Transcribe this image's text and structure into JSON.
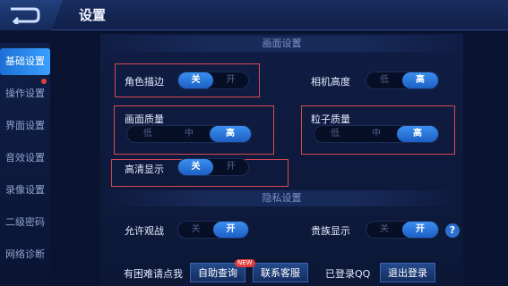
{
  "header": {
    "title": "设置"
  },
  "sidebar": {
    "items": [
      {
        "label": "基础设置"
      },
      {
        "label": "操作设置"
      },
      {
        "label": "界面设置"
      },
      {
        "label": "音效设置"
      },
      {
        "label": "录像设置"
      },
      {
        "label": "二级密码"
      },
      {
        "label": "网络诊断"
      }
    ],
    "active_index": 0
  },
  "sections": {
    "display": {
      "title": "画面设置"
    },
    "privacy": {
      "title": "隐私设置"
    }
  },
  "settings": {
    "outline": {
      "label": "角色描边",
      "options": [
        "关",
        "开"
      ],
      "selected": "关"
    },
    "camera_height": {
      "label": "相机高度",
      "options": [
        "低",
        "高"
      ],
      "selected": "高"
    },
    "image_quality": {
      "label": "画面质量",
      "options": [
        "低",
        "中",
        "高"
      ],
      "selected": "高"
    },
    "particle_quality": {
      "label": "粒子质量",
      "options": [
        "低",
        "中",
        "高"
      ],
      "selected": "高"
    },
    "hd_display": {
      "label": "高清显示",
      "options": [
        "关",
        "开"
      ],
      "selected": "关"
    },
    "allow_watch": {
      "label": "允许观战",
      "options": [
        "关",
        "开"
      ],
      "selected": "开"
    },
    "noble_display": {
      "label": "贵族显示",
      "options": [
        "关",
        "开"
      ],
      "selected": "开"
    }
  },
  "footer": {
    "help_text": "有困难请点我",
    "self_query": "自助查询",
    "new_badge": "NEW",
    "contact": "联系客服",
    "login_status": "已登录QQ",
    "logout": "退出登录"
  },
  "colors": {
    "accent": "#2f7fe6",
    "highlight": "#d8484f"
  }
}
